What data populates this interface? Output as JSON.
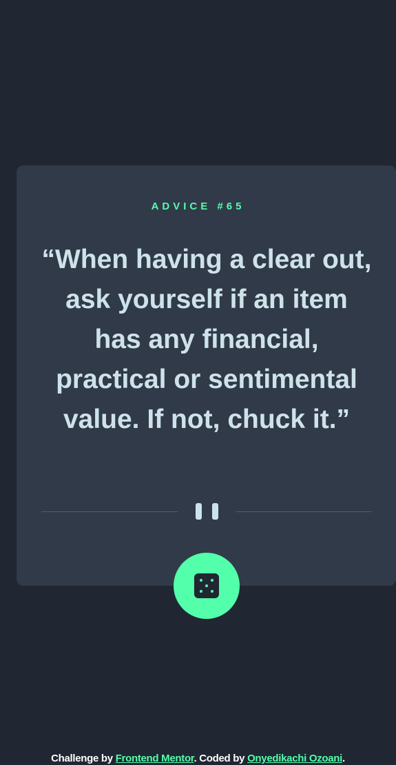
{
  "advice": {
    "number_label": "ADVICE #65",
    "quote": "“When having a clear out, ask yourself if an item has any financial, practical or sentimental value. If not, chuck it.”"
  },
  "icons": {
    "divider": "pause-icon",
    "button": "dice-icon"
  },
  "attribution": {
    "prefix": "Challenge by ",
    "frontend_mentor": "Frontend Mentor",
    "middle": ". Coded by ",
    "author": "Onyedikachi Ozoani",
    "suffix": "."
  },
  "colors": {
    "background": "#202632",
    "card": "#313a48",
    "accent": "#53ffaa",
    "text": "#cee3e9",
    "divider_line": "#4f5d74"
  }
}
